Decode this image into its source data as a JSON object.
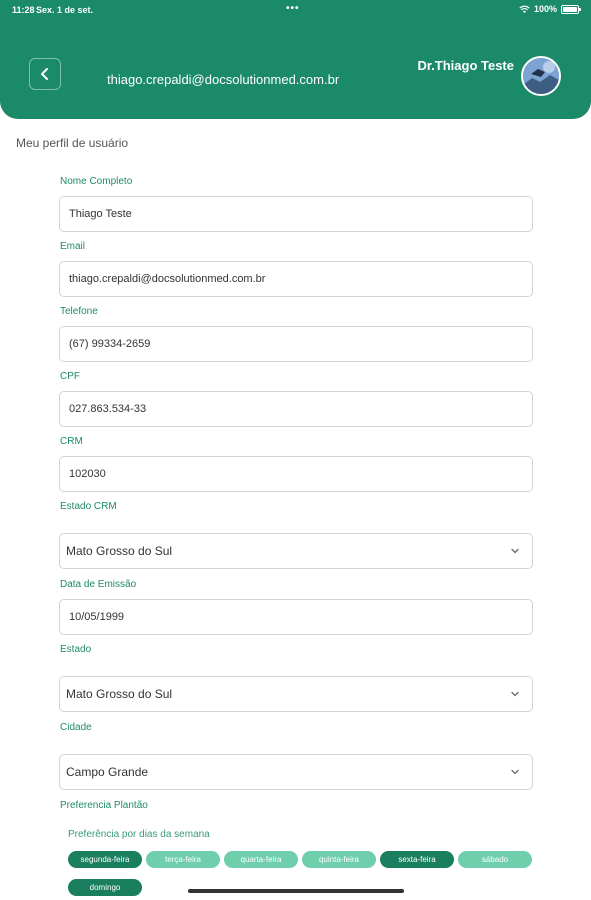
{
  "status_bar": {
    "time": "11:28",
    "date": "Sex. 1 de set.",
    "battery": "100%"
  },
  "header": {
    "email": "thiago.crepaldi@docsolutionmed.com.br",
    "doctor_name": "Dr.Thiago Teste"
  },
  "page_title": "Meu perfil de usuário",
  "form": {
    "nome": {
      "label": "Nome Completo",
      "value": "Thiago Teste"
    },
    "email": {
      "label": "Email",
      "value": "thiago.crepaldi@docsolutionmed.com.br"
    },
    "telefone": {
      "label": "Telefone",
      "value": "(67) 99334-2659"
    },
    "cpf": {
      "label": "CPF",
      "value": "027.863.534-33"
    },
    "crm": {
      "label": "CRM",
      "value": "102030"
    },
    "estado_crm": {
      "label": "Estado CRM",
      "value": "Mato Grosso do Sul"
    },
    "data_emissao": {
      "label": "Data de Emissão",
      "value": "10/05/1999"
    },
    "estado": {
      "label": "Estado",
      "value": "Mato Grosso do Sul"
    },
    "cidade": {
      "label": "Cidade",
      "value": "Campo Grande"
    }
  },
  "preferencia": {
    "label": "Preferencia Plantão",
    "dias_label": "Preferência por dias da semana",
    "dias": [
      {
        "label": "segunda-feira",
        "selected": true
      },
      {
        "label": "terça-feira",
        "selected": false
      },
      {
        "label": "quarta-feira",
        "selected": false
      },
      {
        "label": "quinta-feira",
        "selected": false
      },
      {
        "label": "sexta-feira",
        "selected": true
      },
      {
        "label": "sábado",
        "selected": false
      },
      {
        "label": "domingo",
        "selected": true
      }
    ]
  },
  "colors": {
    "primary": "#1a8a68",
    "chip_selected": "#1a7f5f",
    "chip_unselected": "#6fcfad",
    "label": "#1f8a68"
  }
}
